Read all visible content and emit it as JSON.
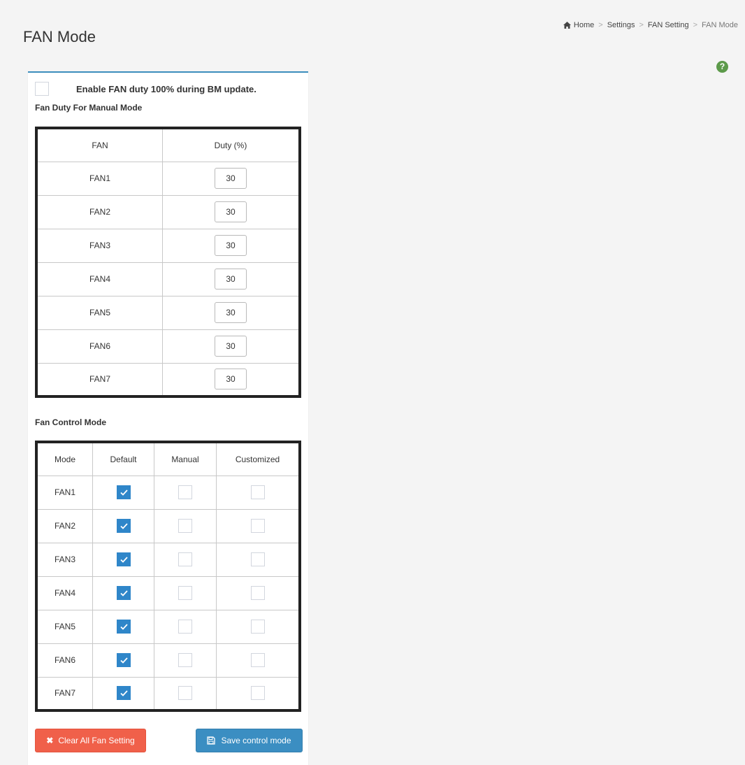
{
  "page": {
    "title": "FAN Mode"
  },
  "breadcrumb": {
    "items": [
      "Home",
      "Settings",
      "FAN Setting"
    ],
    "current": "FAN Mode"
  },
  "enable_option": {
    "label": "Enable FAN duty 100% during BM update.",
    "checked": false
  },
  "manual_section": {
    "label": "Fan Duty For Manual Mode",
    "headers": [
      "FAN",
      "Duty (%)"
    ],
    "rows": [
      {
        "fan": "FAN1",
        "duty": "30"
      },
      {
        "fan": "FAN2",
        "duty": "30"
      },
      {
        "fan": "FAN3",
        "duty": "30"
      },
      {
        "fan": "FAN4",
        "duty": "30"
      },
      {
        "fan": "FAN5",
        "duty": "30"
      },
      {
        "fan": "FAN6",
        "duty": "30"
      },
      {
        "fan": "FAN7",
        "duty": "30"
      }
    ]
  },
  "control_section": {
    "label": "Fan Control Mode",
    "headers": [
      "Mode",
      "Default",
      "Manual",
      "Customized"
    ],
    "rows": [
      {
        "fan": "FAN1",
        "default": true,
        "manual": false,
        "customized": false
      },
      {
        "fan": "FAN2",
        "default": true,
        "manual": false,
        "customized": false
      },
      {
        "fan": "FAN3",
        "default": true,
        "manual": false,
        "customized": false
      },
      {
        "fan": "FAN4",
        "default": true,
        "manual": false,
        "customized": false
      },
      {
        "fan": "FAN5",
        "default": true,
        "manual": false,
        "customized": false
      },
      {
        "fan": "FAN6",
        "default": true,
        "manual": false,
        "customized": false
      },
      {
        "fan": "FAN7",
        "default": true,
        "manual": false,
        "customized": false
      }
    ]
  },
  "buttons": {
    "clear_label": "Clear All Fan Setting",
    "save_label": "Save control mode"
  },
  "icons": {
    "home": "home-icon",
    "help": "help-icon",
    "clear": "close-icon",
    "save": "save-icon"
  },
  "colors": {
    "accent": "#3c8dbc",
    "clear_button": "#f0604a",
    "save_button": "#3b8ec2",
    "help": "#5c9a4a"
  }
}
